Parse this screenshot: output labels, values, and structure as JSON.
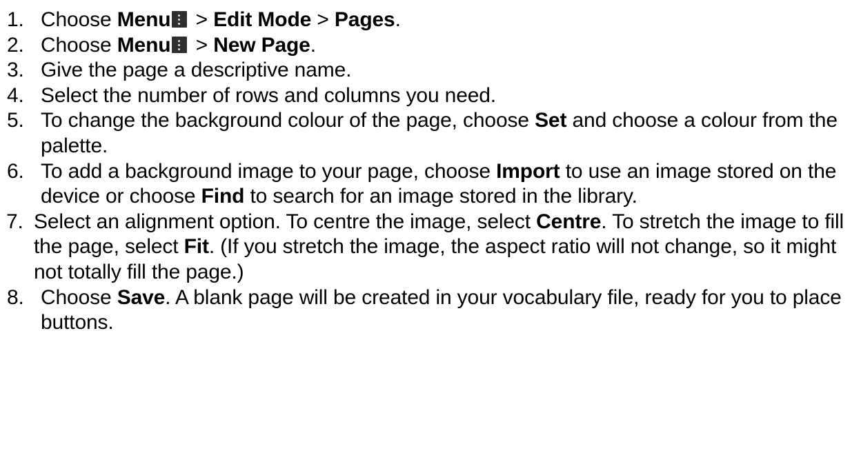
{
  "steps": [
    {
      "num": "1.",
      "parts": [
        {
          "t": "Choose "
        },
        {
          "b": "Menu"
        },
        {
          "icon": "menu-icon"
        },
        {
          "t": " > "
        },
        {
          "b": "Edit Mode"
        },
        {
          "t": " > "
        },
        {
          "b": "Pages"
        },
        {
          "t": "."
        }
      ]
    },
    {
      "num": "2.",
      "parts": [
        {
          "t": "Choose "
        },
        {
          "b": "Menu"
        },
        {
          "icon": "menu-icon"
        },
        {
          "t": " > "
        },
        {
          "b": "New Page"
        },
        {
          "t": "."
        }
      ]
    },
    {
      "num": "3.",
      "parts": [
        {
          "t": "Give the page a descriptive name."
        }
      ]
    },
    {
      "num": "4.",
      "parts": [
        {
          "t": "Select the number of rows and columns you need."
        }
      ]
    },
    {
      "num": "5.",
      "parts": [
        {
          "t": "To change the background colour of the page, choose "
        },
        {
          "b": "Set"
        },
        {
          "t": " and choose a colour from the palette."
        }
      ]
    },
    {
      "num": "6.",
      "parts": [
        {
          "t": "To add a background image to your page, choose "
        },
        {
          "b": "Import"
        },
        {
          "t": " to use an image stored on the device or choose "
        },
        {
          "b": "Find"
        },
        {
          "t": " to search for an image stored in the library."
        }
      ]
    },
    {
      "num": "7.",
      "parts": [
        {
          "t": "Select an alignment option. To centre the image, select "
        },
        {
          "b": "Centre"
        },
        {
          "t": ". To stretch the image to fill the page, select "
        },
        {
          "b": "Fit"
        },
        {
          "t": ". (If you stretch the image, the aspect ratio will not change, so it might not totally fill the page.)"
        }
      ]
    },
    {
      "num": "8.",
      "parts": [
        {
          "t": "Choose "
        },
        {
          "b": "Save"
        },
        {
          "t": ". A blank page will be created in your vocabulary file, ready for you to place buttons."
        }
      ]
    }
  ]
}
